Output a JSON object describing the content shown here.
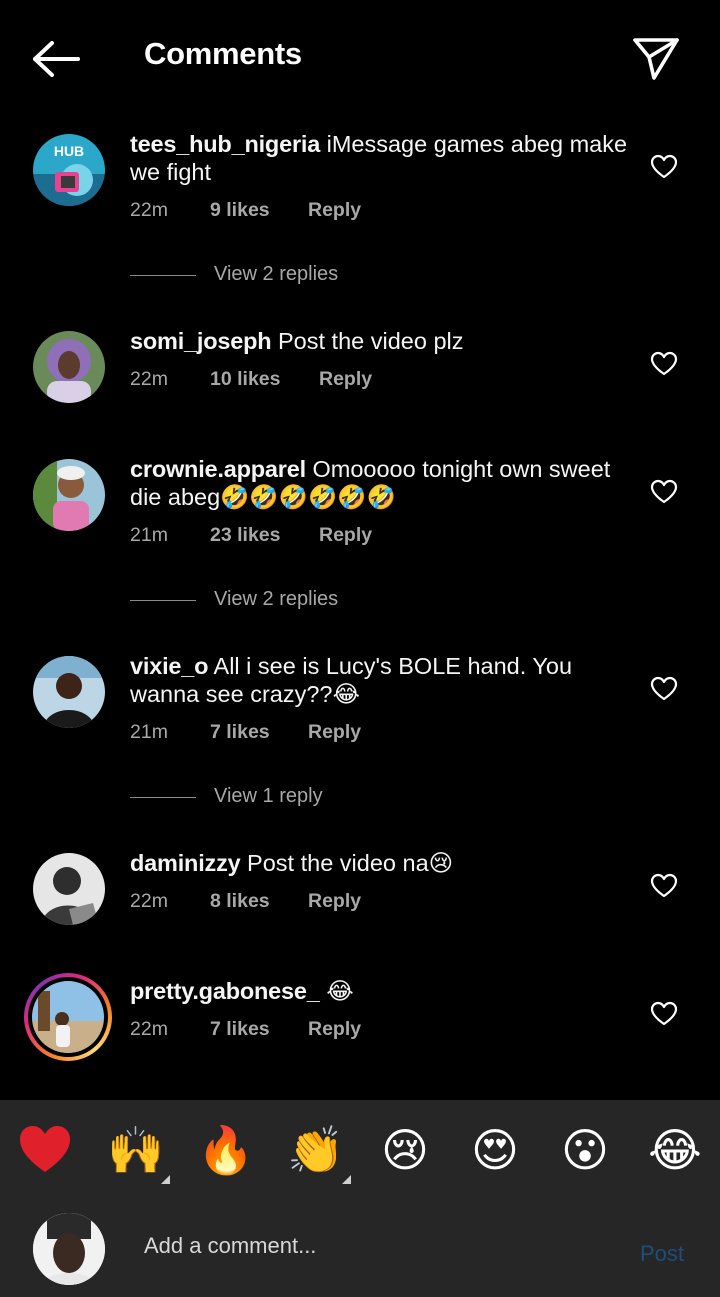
{
  "header": {
    "title": "Comments",
    "back_icon": "arrow-left-icon",
    "send_icon": "paper-plane-icon"
  },
  "comments": [
    {
      "username": "tees_hub_nigeria",
      "text": "iMessage games abeg make we fight",
      "time": "22m",
      "likes": "9 likes",
      "reply": "Reply",
      "view_replies": "View 2 replies"
    },
    {
      "username": "somi_joseph",
      "text": "Post the video plz",
      "time": "22m",
      "likes": "10 likes",
      "reply": "Reply"
    },
    {
      "username": "crownie.apparel",
      "text": "Omooooo tonight own sweet die abeg🤣🤣🤣🤣🤣🤣",
      "time": "21m",
      "likes": "23 likes",
      "reply": "Reply",
      "view_replies": "View 2 replies"
    },
    {
      "username": "vixie_o",
      "text": "All i see is Lucy's BOLE hand. You wanna see crazy??😂",
      "time": "21m",
      "likes": "7 likes",
      "reply": "Reply",
      "view_replies": "View 1 reply"
    },
    {
      "username": "daminizzy",
      "text": "Post the video na😢",
      "time": "22m",
      "likes": "8 likes",
      "reply": "Reply"
    },
    {
      "username": "pretty.gabonese_",
      "text": "😂",
      "time": "22m",
      "likes": "7 likes",
      "reply": "Reply"
    }
  ],
  "quick_reactions": [
    {
      "name": "red-heart-emoji",
      "glyph": "❤️"
    },
    {
      "name": "raising-hands-emoji",
      "glyph": "🙌"
    },
    {
      "name": "fire-emoji",
      "glyph": "🔥"
    },
    {
      "name": "clapping-hands-emoji",
      "glyph": "👏"
    },
    {
      "name": "crying-face-emoji",
      "glyph": "😢"
    },
    {
      "name": "heart-eyes-emoji",
      "glyph": "😍"
    },
    {
      "name": "open-mouth-emoji",
      "glyph": "😮"
    },
    {
      "name": "tears-of-joy-emoji",
      "glyph": "😂"
    }
  ],
  "composer": {
    "placeholder": "Add a comment...",
    "post_label": "Post"
  },
  "colors": {
    "background": "#000000",
    "bar_background": "#262626",
    "secondary_text": "#a8a8a8",
    "post_disabled": "#1d4f7a"
  }
}
